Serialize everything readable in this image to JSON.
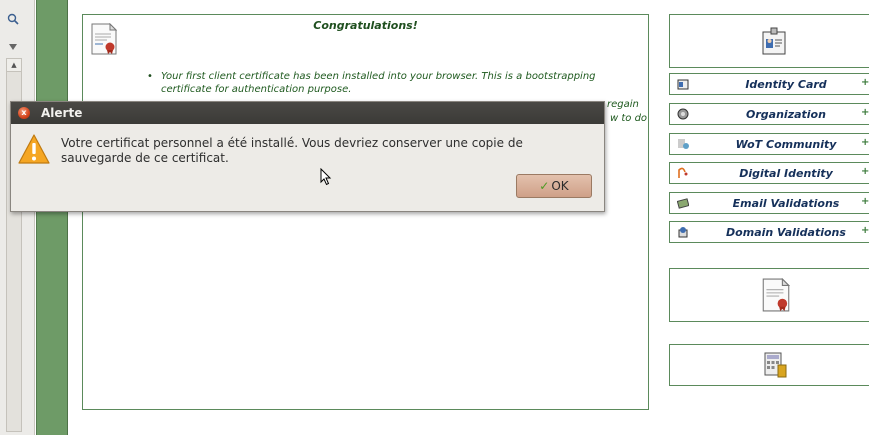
{
  "main": {
    "heading": "Congratulations!",
    "bullet_1": "Your first client certificate has been installed into your browser. This is a bootstrapping certificate for authentication purpose.",
    "partial_right_1": "regain",
    "partial_right_2": "w to do"
  },
  "menu": {
    "items": [
      {
        "label": "Identity Card",
        "icon": "id-card-icon"
      },
      {
        "label": "Organization",
        "icon": "organization-icon"
      },
      {
        "label": "WoT Community",
        "icon": "community-icon"
      },
      {
        "label": "Digital Identity",
        "icon": "digital-identity-icon"
      },
      {
        "label": "Email Validations",
        "icon": "email-icon"
      },
      {
        "label": "Domain Validations",
        "icon": "domain-icon"
      }
    ],
    "plus_glyph": "+"
  },
  "dialog": {
    "title": "Alerte",
    "message_line1": "Votre certificat personnel a été installé. Vous devriez conserver une copie de",
    "message_line2": "sauvegarde de ce certificat.",
    "ok_label": "OK",
    "close_glyph": "x"
  },
  "colors": {
    "green_frame": "#5b8a5b",
    "green_bar": "#6e9b67",
    "menu_text": "#15305a",
    "dialog_title_bg": "#3b3a37",
    "ok_button": "#cfa088"
  }
}
